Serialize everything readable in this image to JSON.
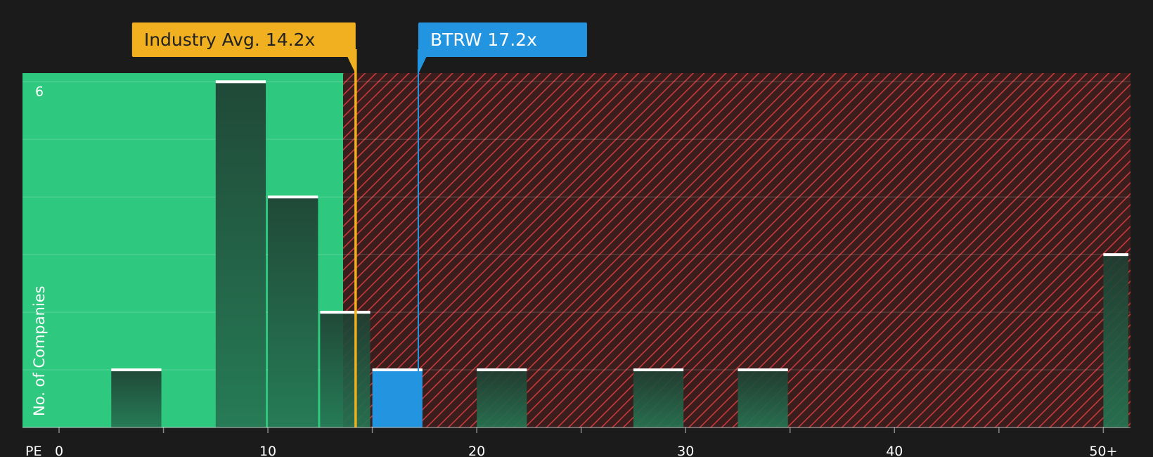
{
  "chart_data": {
    "type": "bar",
    "xlabel": "PE",
    "ylabel": "No. of Companies",
    "x_ticks": [
      {
        "value": 0,
        "label": "0"
      },
      {
        "value": 10,
        "label": "10"
      },
      {
        "value": 20,
        "label": "20"
      },
      {
        "value": 30,
        "label": "30"
      },
      {
        "value": 40,
        "label": "40"
      },
      {
        "value": 50,
        "label": "50+"
      }
    ],
    "xlim": [
      -1.75,
      51.3
    ],
    "ylim": [
      0,
      6.15
    ],
    "y_ticks": [
      {
        "value": 6,
        "label": "6"
      }
    ],
    "bars": [
      {
        "x_start": 2.5,
        "x_end": 5.0,
        "count": 1
      },
      {
        "x_start": 7.5,
        "x_end": 10.0,
        "count": 6
      },
      {
        "x_start": 10.0,
        "x_end": 12.5,
        "count": 4
      },
      {
        "x_start": 12.5,
        "x_end": 15.0,
        "count": 2
      },
      {
        "x_start": 15.0,
        "x_end": 17.5,
        "count": 1,
        "highlight": true
      },
      {
        "x_start": 20.0,
        "x_end": 22.5,
        "count": 1
      },
      {
        "x_start": 27.5,
        "x_end": 30.0,
        "count": 1
      },
      {
        "x_start": 32.5,
        "x_end": 35.0,
        "count": 1
      },
      {
        "x_start": 50.0,
        "x_end": 51.3,
        "count": 3
      }
    ],
    "fair_zone_end": 13.6,
    "markers": [
      {
        "name": "Industry Avg.",
        "label": "Industry Avg. 14.2x",
        "value": 14.2,
        "color": "#f0b020",
        "text_color": "#222222"
      },
      {
        "name": "BTRW",
        "label": "BTRW 17.2x",
        "value": 17.2,
        "color": "#2394e0",
        "text_color": "#ffffff"
      }
    ],
    "grid": true,
    "colors": {
      "fair_zone": "#2ec87e",
      "over_zone": "#3a1d1d",
      "hatch": "#c83a3a",
      "bar": "#1e3e30",
      "highlight_bar": "#2394e0",
      "bar_cap": "#ffffff"
    }
  }
}
